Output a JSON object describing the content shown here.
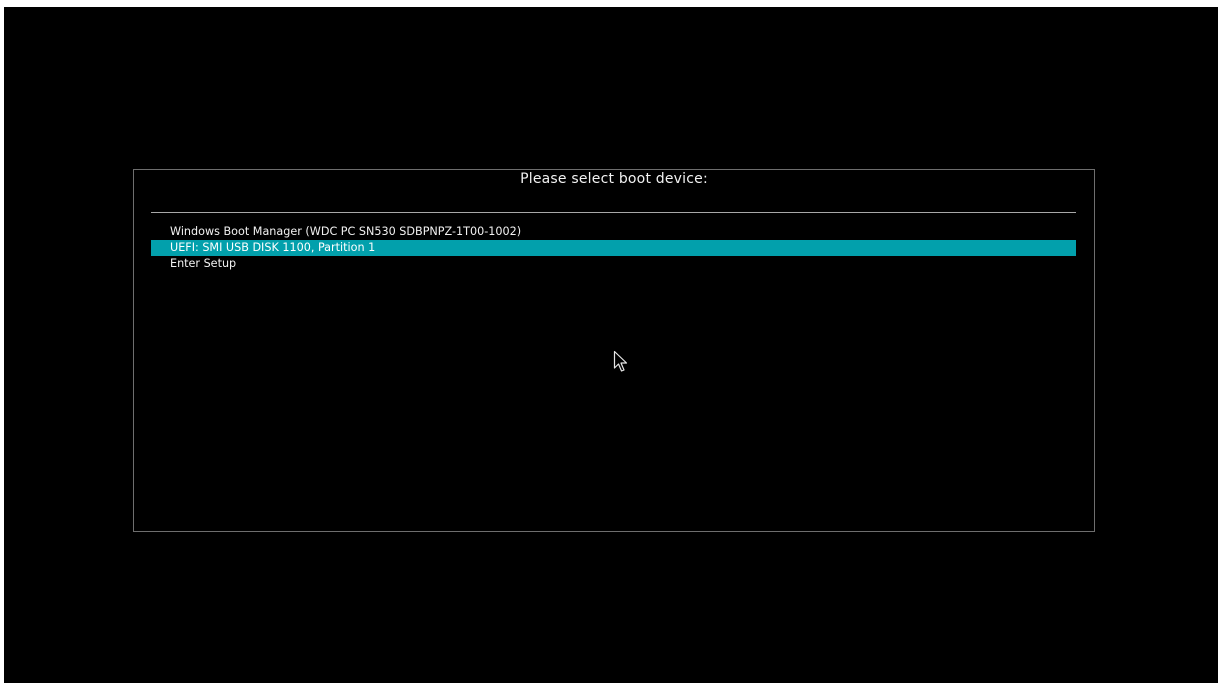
{
  "boot_menu": {
    "title": "Please select boot device:",
    "selected_index": 1,
    "items": [
      {
        "label": "Windows Boot Manager (WDC PC SN530 SDBPNPZ-1T00-1002)"
      },
      {
        "label": "UEFI: SMI USB DISK 1100, Partition 1"
      },
      {
        "label": "Enter Setup"
      }
    ]
  },
  "colors": {
    "background": "#000000",
    "highlight": "#02a0ac",
    "text": "#f2f2f2",
    "border": "#6e6e6e"
  },
  "icons": {
    "pointer": "mouse-pointer-icon"
  }
}
